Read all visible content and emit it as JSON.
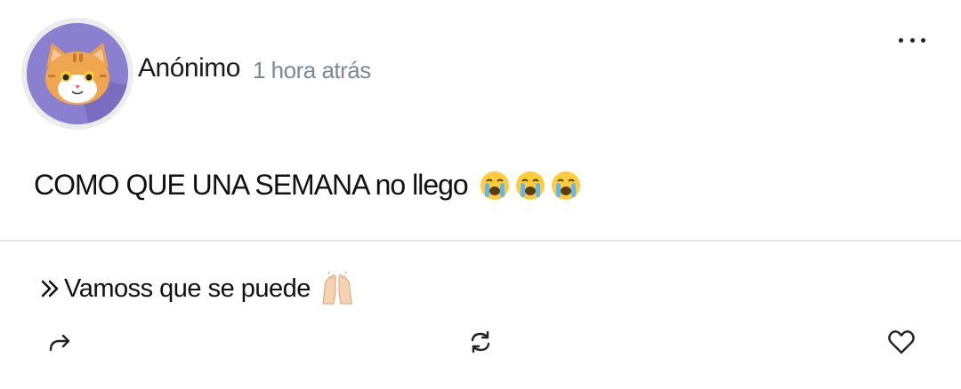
{
  "post": {
    "author": "Anónimo",
    "time": "1 hora atrás",
    "text": "COMO QUE UNA SEMANA no llego",
    "emojis": [
      "loudly-crying-face",
      "loudly-crying-face",
      "loudly-crying-face"
    ]
  },
  "reply": {
    "text": "Vamoss que se puede",
    "emoji": "raising-hands"
  },
  "icons": {
    "more": "more-horizontal-icon",
    "share": "share-arrow-icon",
    "repost": "repost-icon",
    "like": "heart-icon"
  },
  "colors": {
    "avatar_bg": "#8b7fd0",
    "time": "#7b8894",
    "divider": "#e4e4e4"
  }
}
